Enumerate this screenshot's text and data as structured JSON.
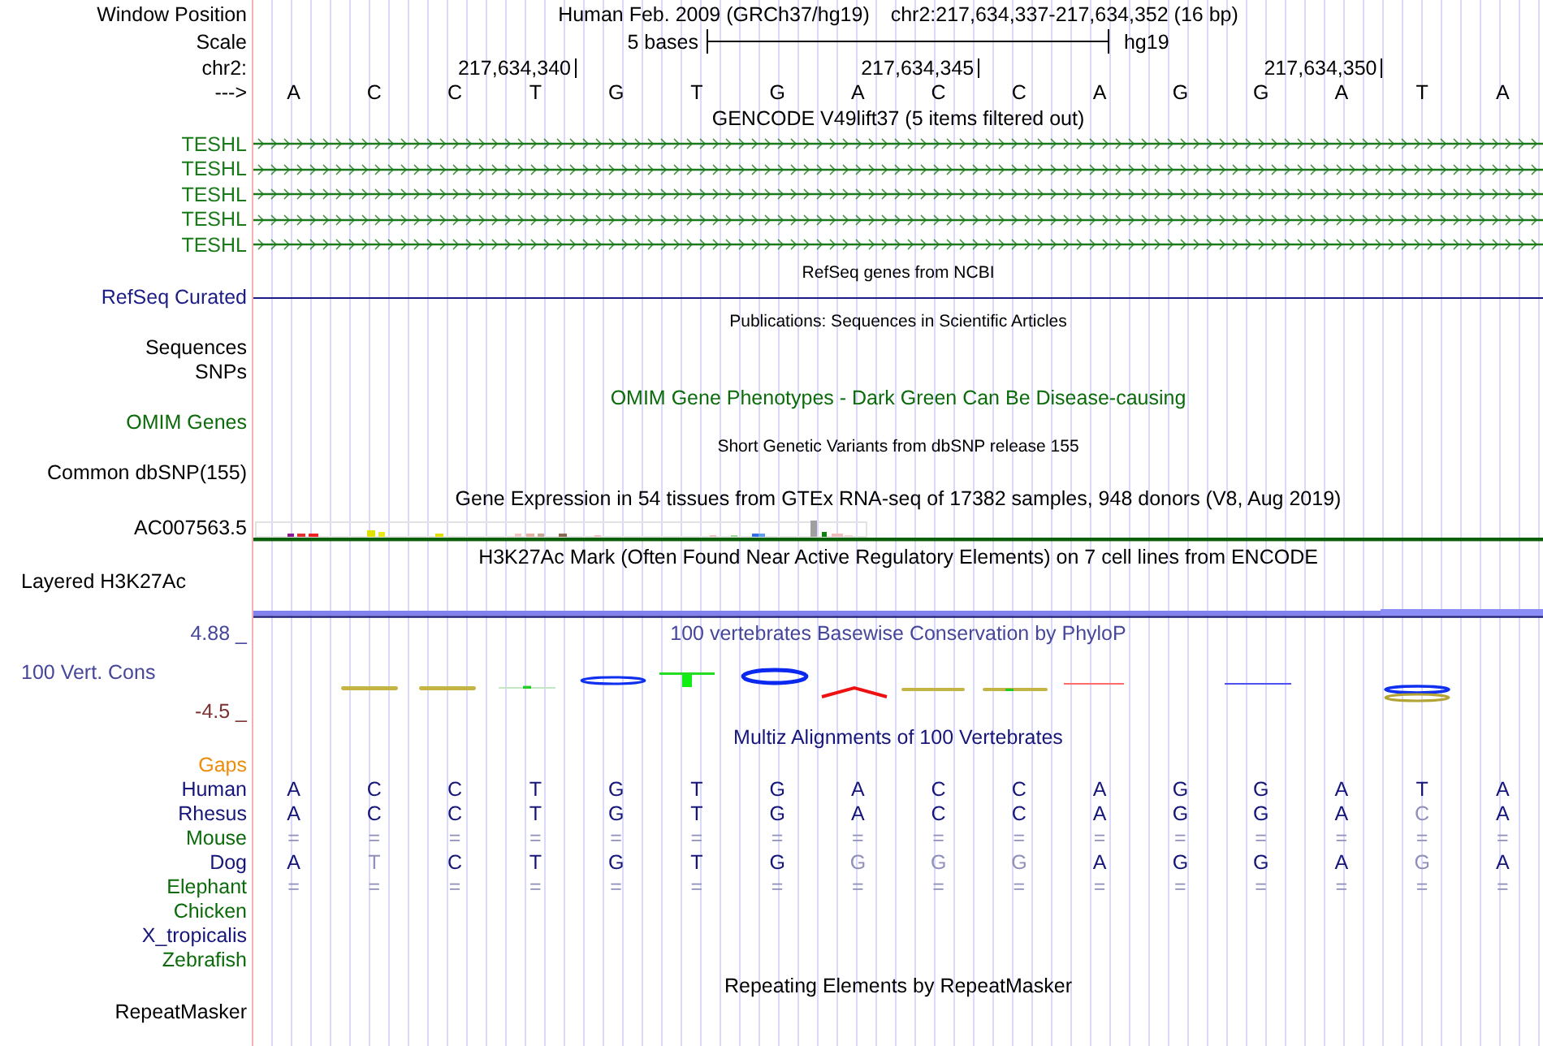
{
  "position_bar": {
    "label": "Window Position",
    "assembly": "Human Feb. 2009 (GRCh37/hg19)",
    "position": "chr2:217,634,337-217,634,352 (16 bp)"
  },
  "scale_bar": {
    "label": "Scale",
    "length": "5 bases",
    "assembly": "hg19"
  },
  "ruler": {
    "label": "chr2:",
    "ticks": [
      "217,634,340",
      "217,634,345",
      "217,634,350"
    ]
  },
  "sequence": {
    "label": "--->",
    "bases": [
      "A",
      "C",
      "C",
      "T",
      "G",
      "T",
      "G",
      "A",
      "C",
      "C",
      "A",
      "G",
      "G",
      "A",
      "T",
      "A"
    ]
  },
  "tracks": [
    {
      "kind": "genes",
      "title": "GENCODE V49lift37 (5 items filtered out)",
      "color": "#1a7a1a",
      "items": [
        {
          "label": "TESHL"
        },
        {
          "label": "TESHL"
        },
        {
          "label": "TESHL"
        },
        {
          "label": "TESHL"
        },
        {
          "label": "TESHL"
        }
      ]
    },
    {
      "kind": "line",
      "title": "RefSeq genes from NCBI",
      "label": "RefSeq Curated",
      "color": "#1c1c86"
    },
    {
      "kind": "minor",
      "title": "Publications: Sequences in Scientific Articles",
      "labels": [
        "Sequences",
        "SNPs"
      ]
    },
    {
      "kind": "labels",
      "title": "OMIM Gene Phenotypes - Dark Green Can Be Disease-causing",
      "labels": [
        "OMIM Genes"
      ],
      "color": "#0b6b0b"
    },
    {
      "kind": "minor",
      "title": "Short Genetic Variants from dbSNP release 155",
      "labels": [
        "Common dbSNP(155)"
      ]
    },
    {
      "kind": "expression",
      "title": "Gene Expression in 54 tissues from GTEx RNA-seq of 17382 samples, 948 donors (V8, Aug 2019)",
      "label": "AC007563.5",
      "color": "#0a5f0a"
    },
    {
      "kind": "signal",
      "title": "H3K27Ac Mark (Often Found Near Active Regulatory Elements) on 7 cell lines from ENCODE",
      "label": "Layered H3K27Ac"
    },
    {
      "kind": "logo",
      "title": "100 vertebrates Basewise Conservation by PhyloP",
      "max_label": "4.88 _",
      "label": "100 Vert. Cons",
      "min_label": "-4.5 _",
      "color": "#46469a"
    },
    {
      "kind": "alignment",
      "title": "Multiz Alignments of 100 Vertebrates",
      "color": "#16167a",
      "gaps_label": "Gaps",
      "species": [
        {
          "name": "Human",
          "color": "#16167a",
          "bases": [
            {
              "base": "A",
              "match": true
            },
            {
              "base": "C",
              "match": true
            },
            {
              "base": "C",
              "match": true
            },
            {
              "base": "T",
              "match": true
            },
            {
              "base": "G",
              "match": true
            },
            {
              "base": "T",
              "match": true
            },
            {
              "base": "G",
              "match": true
            },
            {
              "base": "A",
              "match": true
            },
            {
              "base": "C",
              "match": true
            },
            {
              "base": "C",
              "match": true
            },
            {
              "base": "A",
              "match": true
            },
            {
              "base": "G",
              "match": true
            },
            {
              "base": "G",
              "match": true
            },
            {
              "base": "A",
              "match": true
            },
            {
              "base": "T",
              "match": true
            },
            {
              "base": "A",
              "match": true
            }
          ]
        },
        {
          "name": "Rhesus",
          "color": "#16167a",
          "bases": [
            {
              "base": "A",
              "match": true
            },
            {
              "base": "C",
              "match": true
            },
            {
              "base": "C",
              "match": true
            },
            {
              "base": "T",
              "match": true
            },
            {
              "base": "G",
              "match": true
            },
            {
              "base": "T",
              "match": true
            },
            {
              "base": "G",
              "match": true
            },
            {
              "base": "A",
              "match": true
            },
            {
              "base": "C",
              "match": true
            },
            {
              "base": "C",
              "match": true
            },
            {
              "base": "A",
              "match": true
            },
            {
              "base": "G",
              "match": true
            },
            {
              "base": "G",
              "match": true
            },
            {
              "base": "A",
              "match": true
            },
            {
              "base": "C",
              "match": false
            },
            {
              "base": "A",
              "match": true
            }
          ]
        },
        {
          "name": "Mouse",
          "color": "#0b6b0b",
          "bases": [
            {
              "base": "=",
              "match": false
            },
            {
              "base": "=",
              "match": false
            },
            {
              "base": "=",
              "match": false
            },
            {
              "base": "=",
              "match": false
            },
            {
              "base": "=",
              "match": false
            },
            {
              "base": "=",
              "match": false
            },
            {
              "base": "=",
              "match": false
            },
            {
              "base": "=",
              "match": false
            },
            {
              "base": "=",
              "match": false
            },
            {
              "base": "=",
              "match": false
            },
            {
              "base": "=",
              "match": false
            },
            {
              "base": "=",
              "match": false
            },
            {
              "base": "=",
              "match": false
            },
            {
              "base": "=",
              "match": false
            },
            {
              "base": "=",
              "match": false
            },
            {
              "base": "=",
              "match": false
            }
          ]
        },
        {
          "name": "Dog",
          "color": "#16167a",
          "bases": [
            {
              "base": "A",
              "match": true
            },
            {
              "base": "T",
              "match": false
            },
            {
              "base": "C",
              "match": true
            },
            {
              "base": "T",
              "match": true
            },
            {
              "base": "G",
              "match": true
            },
            {
              "base": "T",
              "match": true
            },
            {
              "base": "G",
              "match": true
            },
            {
              "base": "G",
              "match": false
            },
            {
              "base": "G",
              "match": false
            },
            {
              "base": "G",
              "match": false
            },
            {
              "base": "A",
              "match": true
            },
            {
              "base": "G",
              "match": true
            },
            {
              "base": "G",
              "match": true
            },
            {
              "base": "A",
              "match": true
            },
            {
              "base": "G",
              "match": false
            },
            {
              "base": "A",
              "match": true
            }
          ]
        },
        {
          "name": "Elephant",
          "color": "#0b6b0b",
          "bases": [
            {
              "base": "=",
              "match": false
            },
            {
              "base": "=",
              "match": false
            },
            {
              "base": "=",
              "match": false
            },
            {
              "base": "=",
              "match": false
            },
            {
              "base": "=",
              "match": false
            },
            {
              "base": "=",
              "match": false
            },
            {
              "base": "=",
              "match": false
            },
            {
              "base": "=",
              "match": false
            },
            {
              "base": "=",
              "match": false
            },
            {
              "base": "=",
              "match": false
            },
            {
              "base": "=",
              "match": false
            },
            {
              "base": "=",
              "match": false
            },
            {
              "base": "=",
              "match": false
            },
            {
              "base": "=",
              "match": false
            },
            {
              "base": "=",
              "match": false
            },
            {
              "base": "=",
              "match": false
            }
          ]
        },
        {
          "name": "Chicken",
          "color": "#0b6b0b"
        },
        {
          "name": "X_tropicalis",
          "color": "#16167a"
        },
        {
          "name": "Zebrafish",
          "color": "#0b6b0b"
        }
      ]
    },
    {
      "kind": "labels",
      "title": "Repeating Elements by RepeatMasker",
      "labels": [
        "RepeatMasker"
      ]
    }
  ]
}
